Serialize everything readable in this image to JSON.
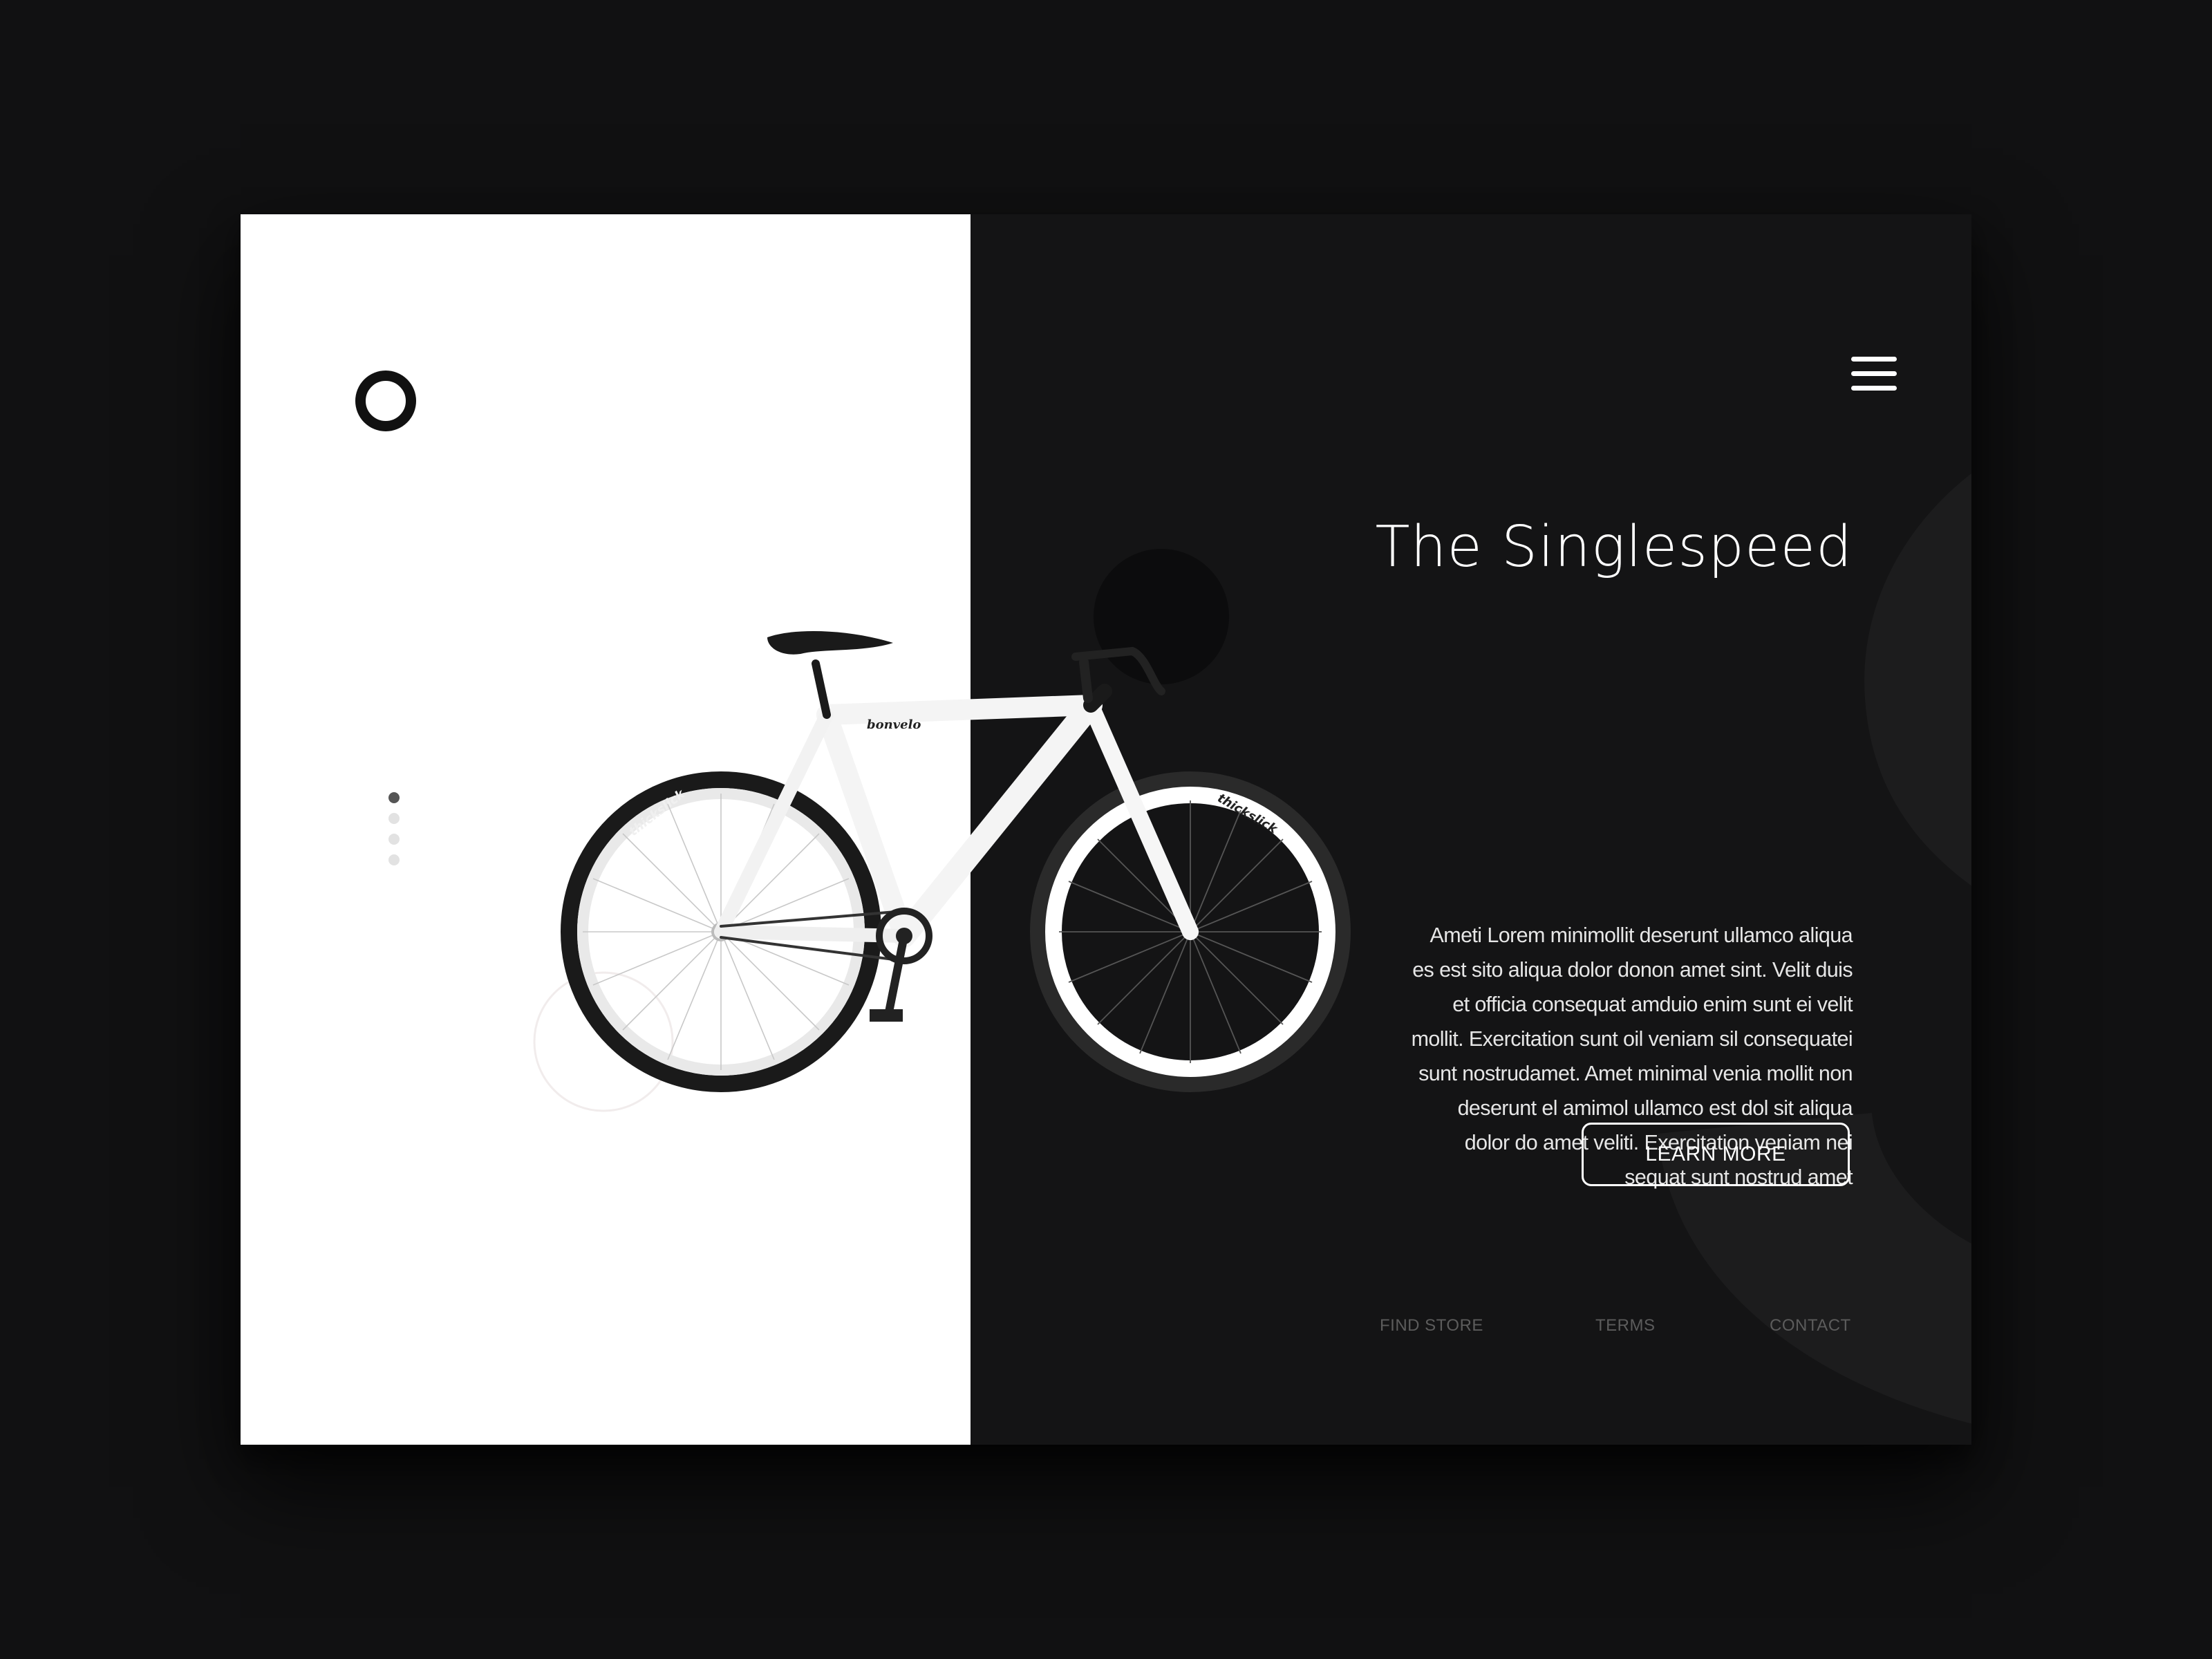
{
  "hero": {
    "title": "The Singlespeed",
    "description": "Ameti Lorem  minimollit  deserunt ullamco aliqua es est sito aliqua dolor donon amet sint. Velit duis et officia consequat amduio enim sunt ei velit mollit. Exercitation sunt oil veniam sil consequatei sunt nostrudamet. Amet minimal venia mollit non deserunt el amimol ullamco est dol sit aliqua dolor do amet  veliti. Exercitation veniam nei sequat sunt nostrud amet",
    "cta_label": "LEARN MORE"
  },
  "bike": {
    "frame_brand": "bonvelo",
    "tire_brand": "thickslick"
  },
  "carousel": {
    "total_slides": 4,
    "active_slide": 1
  },
  "footer": {
    "links": [
      "FIND STORE",
      "TERMS",
      "CONTACT"
    ]
  },
  "colors": {
    "page_background": "#111112",
    "dark_panel": "#141415",
    "light_panel": "#ffffff",
    "text_primary": "#ffffff",
    "text_muted": "#5c5c5c"
  },
  "icons": {
    "logo": "ring-logo-icon",
    "menu": "hamburger-menu-icon"
  }
}
